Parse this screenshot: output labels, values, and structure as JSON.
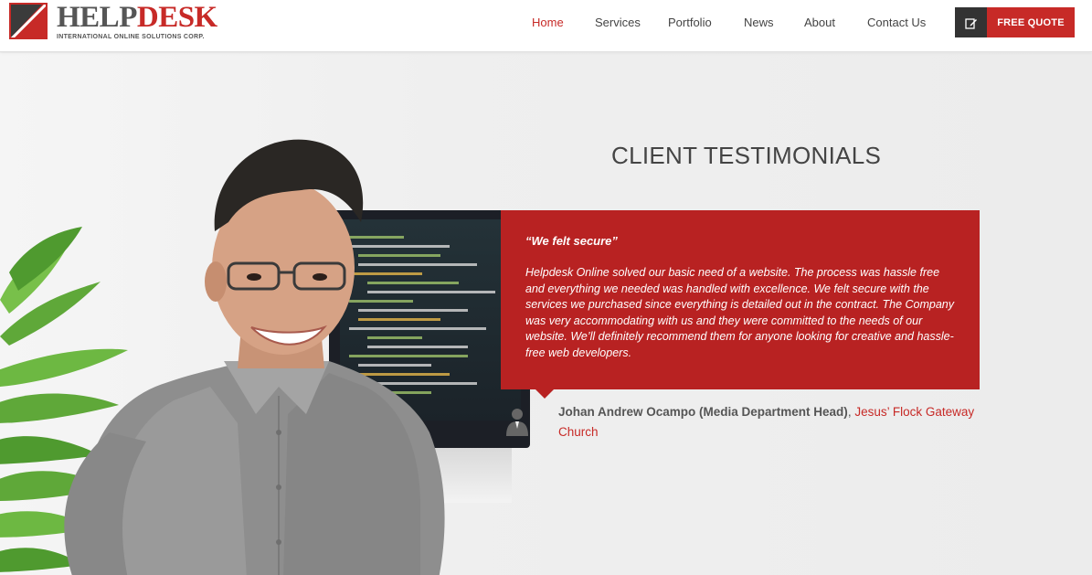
{
  "logo": {
    "word_part1": "HELP",
    "word_part2": "DESK",
    "tagline": "INTERNATIONAL ONLINE SOLUTIONS CORP."
  },
  "nav": {
    "items": [
      {
        "label": "Home",
        "active": true
      },
      {
        "label": "Services",
        "active": false
      },
      {
        "label": "Portfolio",
        "active": false
      },
      {
        "label": "News",
        "active": false
      },
      {
        "label": "About",
        "active": false
      },
      {
        "label": "Contact Us",
        "active": false
      }
    ],
    "quote_icon": "edit-icon",
    "quote_label": "FREE QUOTE"
  },
  "colors": {
    "brand_red": "#c72a27",
    "card_red": "#b82222",
    "dark": "#333333"
  },
  "testimonials": {
    "title": "CLIENT TESTIMONIALS",
    "headline": "“We felt secure”",
    "body": "Helpdesk Online solved our basic need of a website. The process was hassle free and everything we needed was handled with excellence. We felt secure with the services we purchased since everything is detailed out in the contract. The Company was very accommodating with us and they were committed to the needs of our website. We’ll definitely recommend them for anyone looking for creative and hassle-free web developers.",
    "author_name": "Johan Andrew Ocampo (Media Department Head)",
    "author_separator": ", ",
    "author_org": "Jesus’ Flock Gateway Church",
    "author_icon": "person-icon"
  }
}
